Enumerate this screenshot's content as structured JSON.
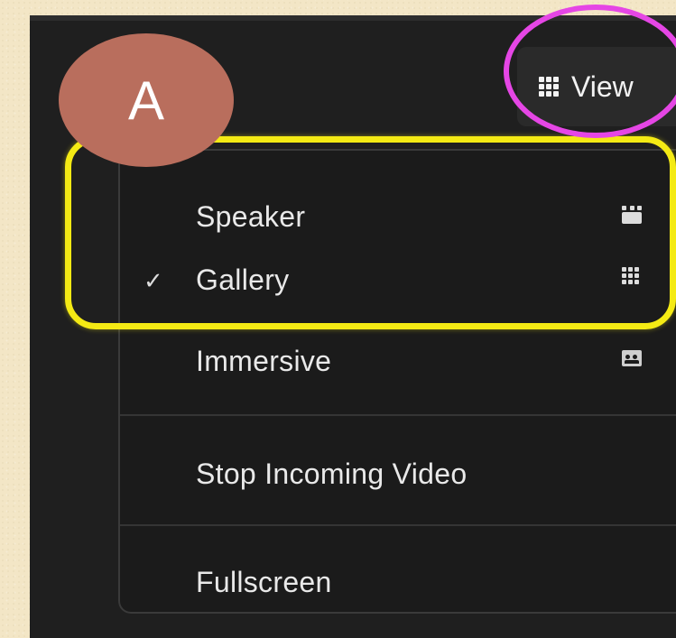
{
  "view_button": {
    "label": "View",
    "icon": "grid-icon"
  },
  "menu": {
    "items": [
      {
        "label": "Speaker",
        "icon": "speaker-view-icon",
        "checked": false
      },
      {
        "label": "Gallery",
        "icon": "gallery-view-icon",
        "checked": true,
        "check_mark": "✓"
      },
      {
        "label": "Immersive",
        "icon": "immersive-view-icon",
        "checked": false
      },
      {
        "label": "Stop Incoming Video"
      },
      {
        "label": "Fullscreen"
      }
    ]
  },
  "annotations": {
    "badge_label": "A",
    "highlight_color_yellow": "#f4ea14",
    "highlight_color_magenta": "#e546e5",
    "badge_color": "#b96e5d"
  }
}
